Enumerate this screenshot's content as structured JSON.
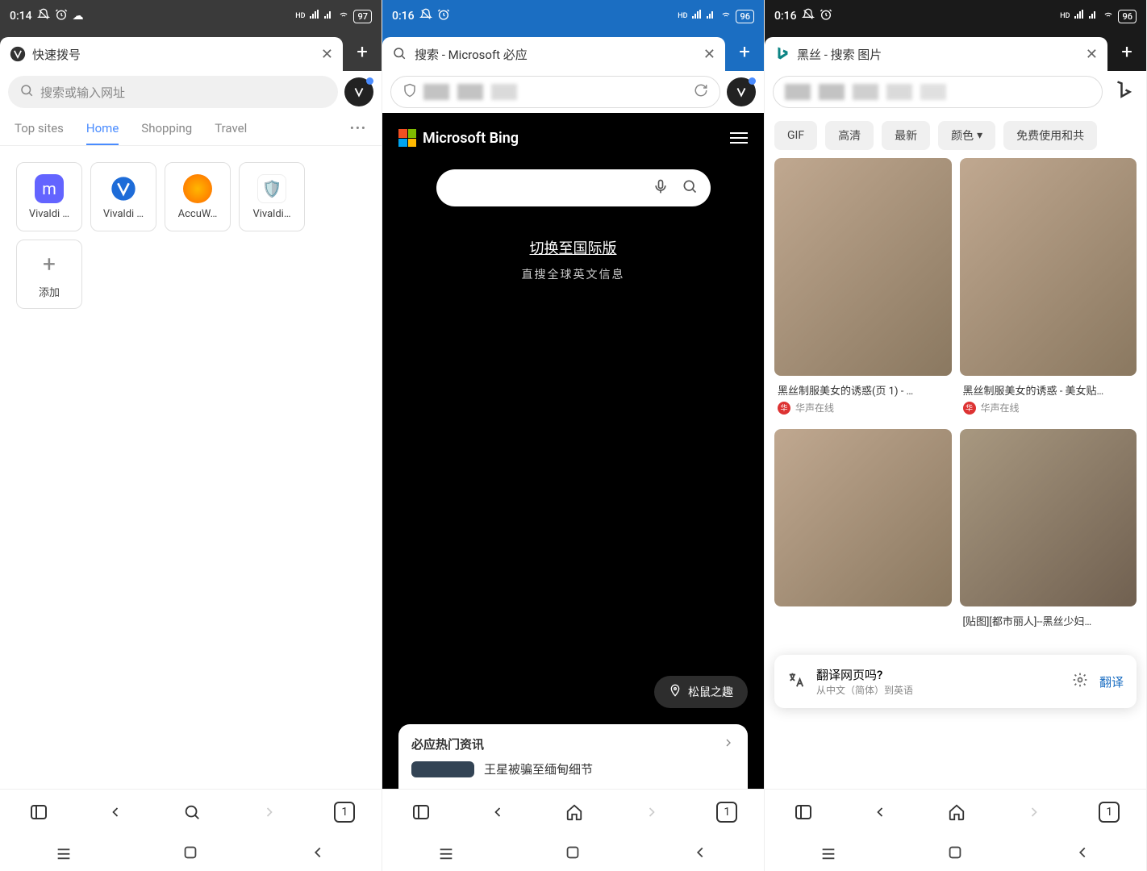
{
  "phones": [
    {
      "status": {
        "time": "0:14",
        "battery": "97"
      },
      "tab": {
        "title": "快速拨号"
      },
      "url": {
        "placeholder": "搜索或输入网址"
      },
      "navTabs": {
        "items": [
          "Top sites",
          "Home",
          "Shopping",
          "Travel"
        ],
        "more": "•••",
        "activeIndex": 1
      },
      "dials": [
        {
          "label": "Vivaldi …",
          "color": "#6364ff"
        },
        {
          "label": "Vivaldi …",
          "color": "#1e6cd8"
        },
        {
          "label": "AccuW…",
          "color": "#ff8a00"
        },
        {
          "label": "Vivaldi…",
          "color": "#d0494a"
        }
      ],
      "addDial": "添加",
      "bottom": {
        "tabCount": "1"
      }
    },
    {
      "status": {
        "time": "0:16",
        "battery": "96"
      },
      "tab": {
        "title": "搜索 - Microsoft 必应"
      },
      "bing": {
        "name": "Microsoft Bing",
        "switch": "切换至国际版",
        "subtitle": "直搜全球英文信息",
        "location": "松鼠之趣",
        "news": {
          "title": "必应热门资讯",
          "headline": "王星被骗至缅甸细节"
        }
      },
      "bottom": {
        "tabCount": "1"
      }
    },
    {
      "status": {
        "time": "0:16",
        "battery": "96"
      },
      "tab": {
        "title": "黑丝 - 搜索 图片"
      },
      "filters": [
        "GIF",
        "高清",
        "最新",
        "颜色",
        "免费使用和共"
      ],
      "results": [
        {
          "caption": "黑丝制服美女的诱惑(页 1) - …",
          "source": "华声在线"
        },
        {
          "caption": "黑丝制服美女的诱惑 - 美女贴…",
          "source": "华声在线"
        },
        {
          "caption": "",
          "source": ""
        },
        {
          "caption": "[贴图][都市丽人]--黑丝少妇…",
          "source": ""
        }
      ],
      "translate": {
        "title": "翻译网页吗?",
        "subtitle": "从中文（简体）到英语",
        "action": "翻译"
      },
      "bottom": {
        "tabCount": "1"
      }
    }
  ],
  "icons": {
    "bellOff": "🔕",
    "alarm": "⏰",
    "cloud": "☁"
  }
}
